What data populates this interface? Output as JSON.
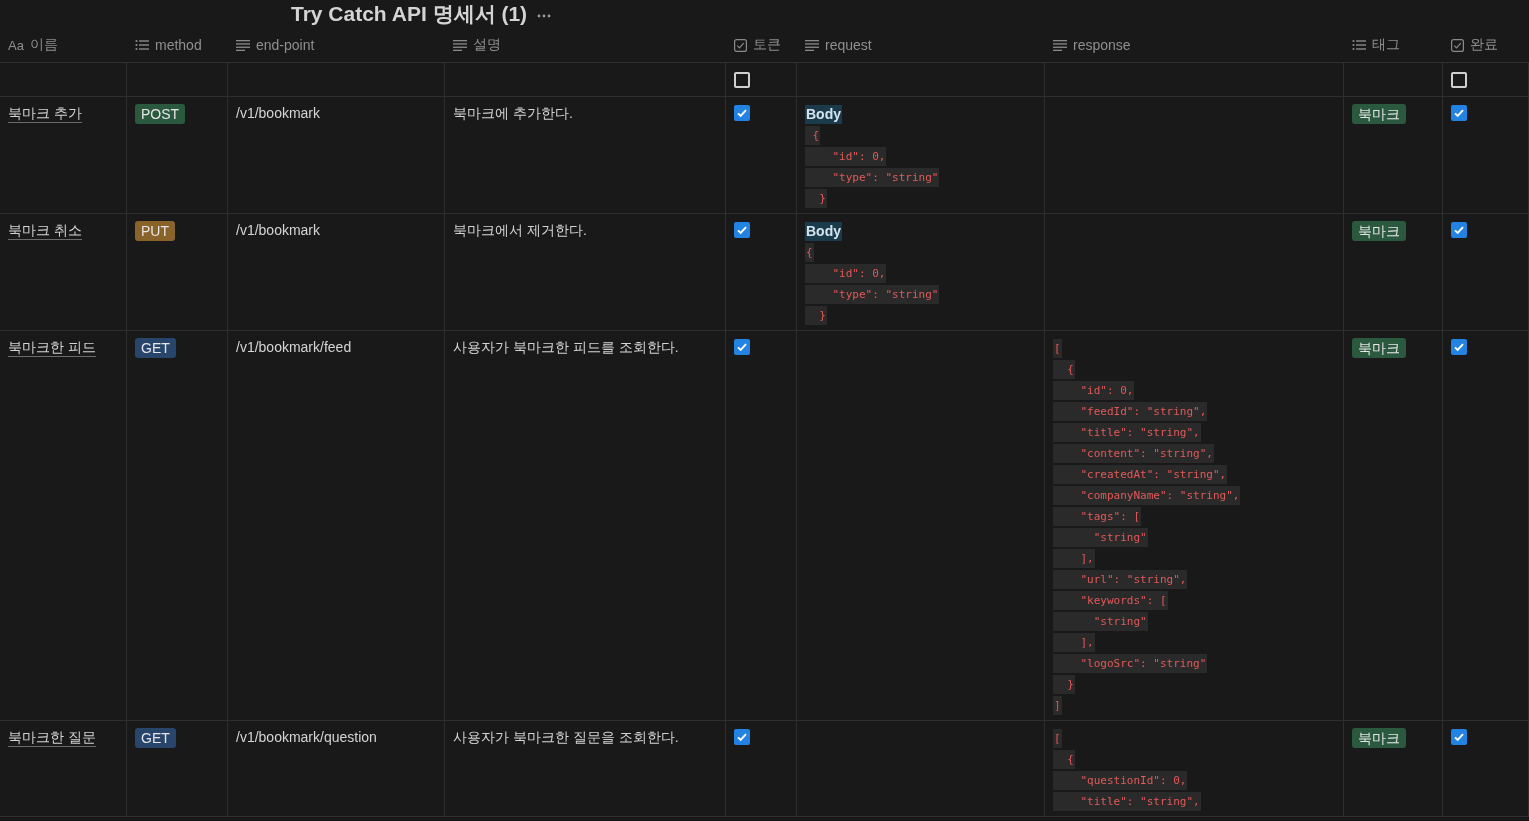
{
  "title": "Try Catch API 명세서 (1)",
  "columns": [
    {
      "label": "이름",
      "kind": "title",
      "icon_text": "Aa"
    },
    {
      "label": "method",
      "kind": "select"
    },
    {
      "label": "end-point",
      "kind": "text"
    },
    {
      "label": "설명",
      "kind": "text"
    },
    {
      "label": "토큰",
      "kind": "checkbox"
    },
    {
      "label": "request",
      "kind": "text"
    },
    {
      "label": "response",
      "kind": "text"
    },
    {
      "label": "태그",
      "kind": "select"
    },
    {
      "label": "완료",
      "kind": "checkbox"
    }
  ],
  "empty_row": {
    "token": false,
    "done": false
  },
  "rows": [
    {
      "name": "북마크 추가",
      "method": {
        "label": "POST",
        "color": "#2b593f"
      },
      "endpoint": "/v1/bookmark",
      "description": "북마크에 추가한다.",
      "token": true,
      "request": {
        "label": "Body",
        "lines": [
          " {",
          "    \"id\": 0,",
          "    \"type\": \"string\"",
          "  }"
        ]
      },
      "tag": {
        "label": "북마크",
        "color": "#2b593f"
      },
      "done": true
    },
    {
      "name": "북마크 취소",
      "method": {
        "label": "PUT",
        "color": "#89632a"
      },
      "endpoint": "/v1/bookmark",
      "description": "북마크에서 제거한다.",
      "token": true,
      "request": {
        "label": "Body",
        "lines": [
          "{",
          "    \"id\": 0,",
          "    \"type\": \"string\"",
          "  }"
        ]
      },
      "tag": {
        "label": "북마크",
        "color": "#2b593f"
      },
      "done": true
    },
    {
      "name": "북마크한 피드",
      "method": {
        "label": "GET",
        "color": "#28456c"
      },
      "endpoint": "/v1/bookmark/feed",
      "description": "사용자가 북마크한 피드를 조회한다.",
      "token": true,
      "response": {
        "lines": [
          "[",
          "  {",
          "    \"id\": 0,",
          "    \"feedId\": \"string\",",
          "    \"title\": \"string\",",
          "    \"content\": \"string\",",
          "    \"createdAt\": \"string\",",
          "    \"companyName\": \"string\",",
          "    \"tags\": [",
          "      \"string\"",
          "    ],",
          "    \"url\": \"string\",",
          "    \"keywords\": [",
          "      \"string\"",
          "    ],",
          "    \"logoSrc\": \"string\"",
          "  }",
          "]"
        ]
      },
      "tag": {
        "label": "북마크",
        "color": "#2b593f"
      },
      "done": true
    },
    {
      "name": "북마크한 질문",
      "method": {
        "label": "GET",
        "color": "#28456c"
      },
      "endpoint": "/v1/bookmark/question",
      "description": "사용자가 북마크한 질문을 조회한다.",
      "token": true,
      "response": {
        "lines": [
          "[",
          "  {",
          "    \"questionId\": 0,",
          "    \"title\": \"string\","
        ]
      },
      "tag": {
        "label": "북마크",
        "color": "#2b593f"
      },
      "done": true
    }
  ]
}
